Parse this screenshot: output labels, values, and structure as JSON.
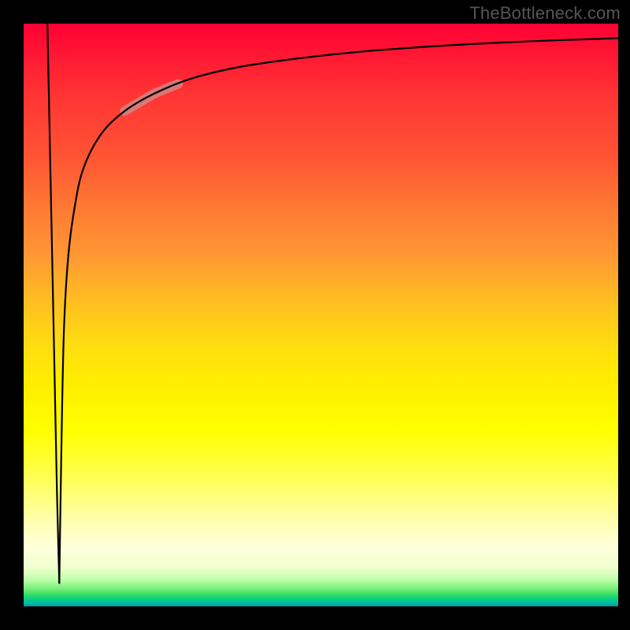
{
  "watermark": "TheBottleneck.com",
  "colors": {
    "gradient_top": "#ff0033",
    "gradient_mid": "#ffee00",
    "gradient_bottom": "#009999",
    "curve": "#000000",
    "highlight": "#cc8f8f",
    "frame": "#000000"
  },
  "chart_data": {
    "type": "line",
    "title": "",
    "xlabel": "",
    "ylabel": "",
    "xlim": [
      0,
      100
    ],
    "ylim": [
      0,
      100
    ],
    "grid": false,
    "legend": false,
    "background": "vertical-gradient red→yellow→green (heatmap-style)",
    "series": [
      {
        "name": "descending-branch",
        "x": [
          4.0,
          4.4,
          4.8,
          5.2,
          5.6,
          6.0
        ],
        "values": [
          100,
          80,
          60,
          40,
          20,
          4
        ]
      },
      {
        "name": "ascending-log-branch",
        "x": [
          6.0,
          6.4,
          6.8,
          7.5,
          8.5,
          10,
          13,
          17,
          22,
          28,
          36,
          46,
          58,
          72,
          86,
          100
        ],
        "values": [
          4,
          30,
          48,
          60,
          68,
          75,
          81,
          85,
          88,
          90.5,
          92.5,
          94,
          95.3,
          96.3,
          97,
          97.5
        ]
      }
    ],
    "annotations": [
      {
        "type": "segment-highlight",
        "series": "ascending-log-branch",
        "x_range": [
          17,
          26
        ],
        "y_range": [
          85,
          90
        ],
        "style": "thick rounded salmon stroke"
      }
    ]
  }
}
